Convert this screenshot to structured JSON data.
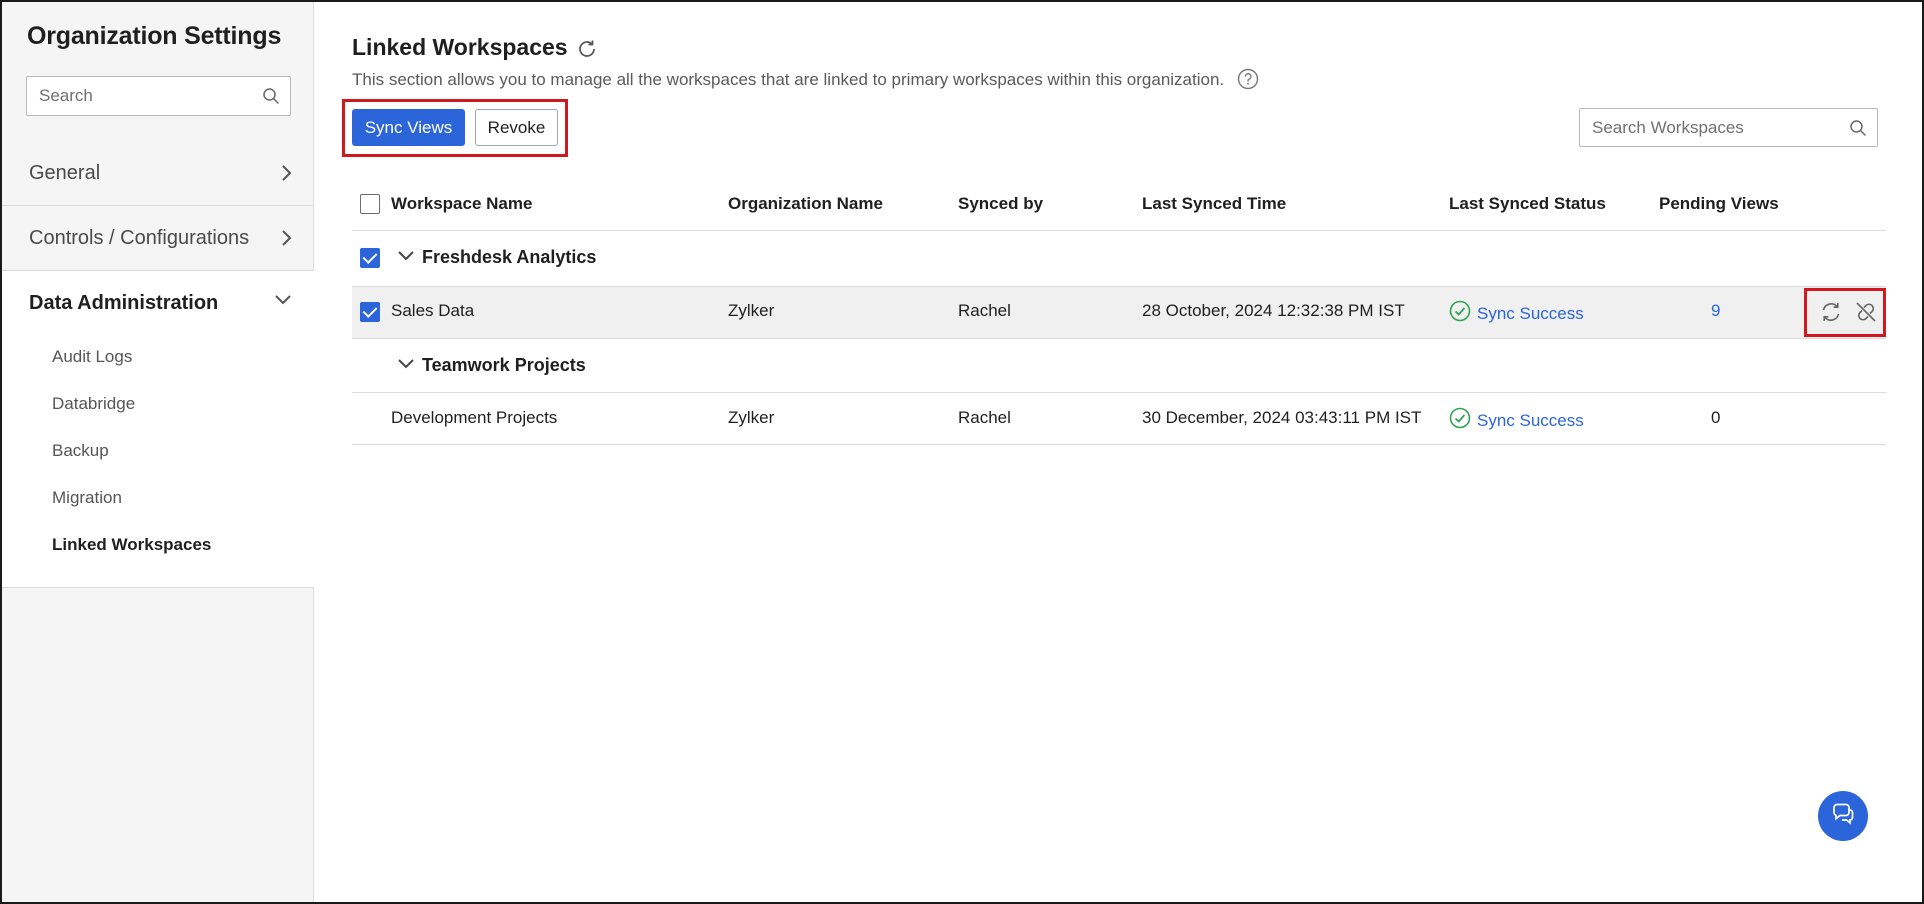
{
  "sidebar": {
    "title": "Organization Settings",
    "search_placeholder": "Search",
    "groups": [
      {
        "label": "General"
      },
      {
        "label": "Controls / Configurations"
      },
      {
        "label": "Data Administration"
      }
    ],
    "sub_items": [
      {
        "label": "Audit Logs"
      },
      {
        "label": "Databridge"
      },
      {
        "label": "Backup"
      },
      {
        "label": "Migration"
      },
      {
        "label": "Linked Workspaces"
      }
    ]
  },
  "main": {
    "title": "Linked Workspaces",
    "description": "This section allows you to manage all the workspaces that are linked to primary workspaces within this organization.",
    "sync_views_label": "Sync Views",
    "revoke_label": "Revoke",
    "search_placeholder": "Search Workspaces"
  },
  "table": {
    "headers": [
      "Workspace Name",
      "Organization Name",
      "Synced by",
      "Last Synced Time",
      "Last Synced Status",
      "Pending Views"
    ],
    "groups": [
      {
        "name": "Freshdesk Analytics",
        "rows": [
          {
            "workspace": "Sales Data",
            "organization": "Zylker",
            "synced_by": "Rachel",
            "last_synced_time": "28 October, 2024 12:32:38 PM IST",
            "status": "Sync Success",
            "pending": "9"
          }
        ]
      },
      {
        "name": "Teamwork Projects",
        "rows": [
          {
            "workspace": "Development Projects",
            "organization": "Zylker",
            "synced_by": "Rachel",
            "last_synced_time": "30 December, 2024 03:43:11 PM IST",
            "status": "Sync Success",
            "pending": "0"
          }
        ]
      }
    ]
  },
  "colors": {
    "accent": "#2b65d9",
    "highlight": "#d0191f",
    "success": "#2ea44f"
  },
  "icons": [
    "search-icon",
    "chevron-right-icon",
    "chevron-down-icon",
    "refresh-icon",
    "help-icon",
    "check-circle-icon",
    "sync-icon",
    "unlink-icon",
    "chat-icon"
  ]
}
